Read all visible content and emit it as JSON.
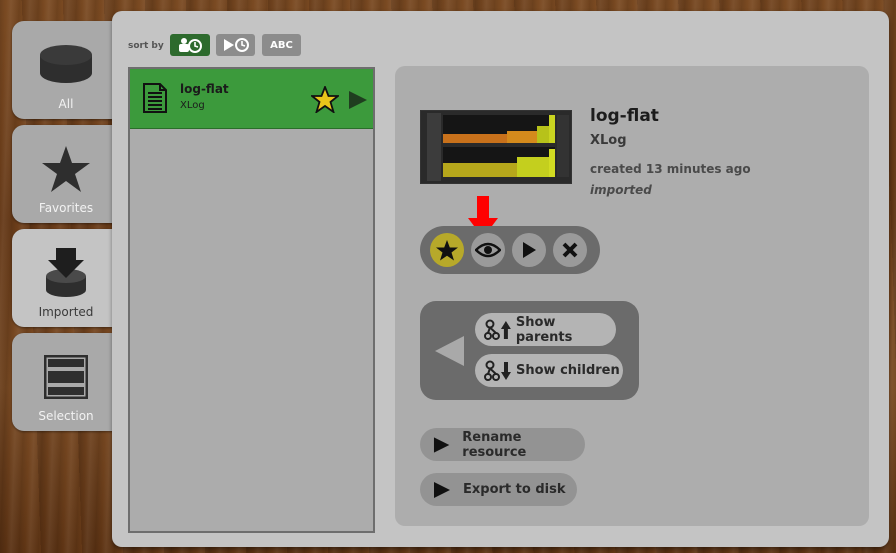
{
  "sidebar": {
    "tabs": [
      {
        "label": "All",
        "icon": "database-icon"
      },
      {
        "label": "Favorites",
        "icon": "star-icon"
      },
      {
        "label": "Imported",
        "icon": "import-icon"
      },
      {
        "label": "Selection",
        "icon": "selection-icon"
      }
    ],
    "active": "Imported"
  },
  "sort": {
    "label": "sort by",
    "buttons": [
      {
        "name": "sort-by-creation",
        "icon": "person-clock-icon",
        "active": true
      },
      {
        "name": "sort-by-play",
        "icon": "play-clock-icon",
        "active": false
      },
      {
        "name": "sort-alphabetical",
        "label": "ABC",
        "active": false
      }
    ]
  },
  "list": {
    "items": [
      {
        "name": "log-flat",
        "type": "XLog",
        "favorite": true,
        "selected": true
      }
    ]
  },
  "detail": {
    "title": "log-flat",
    "type": "XLog",
    "created": "created 13 minutes ago",
    "status": "imported",
    "actions": [
      "favorite",
      "view",
      "play",
      "delete"
    ],
    "nav": {
      "parents_label": "Show parents",
      "children_label": "Show children"
    },
    "rename_label": "Rename resource",
    "export_label": "Export to disk"
  },
  "colors": {
    "selected_row": "#3c9a3c",
    "active_sort": "#2d6a2d",
    "star": "#e8c41a",
    "annotation_arrow": "#ff0000"
  }
}
